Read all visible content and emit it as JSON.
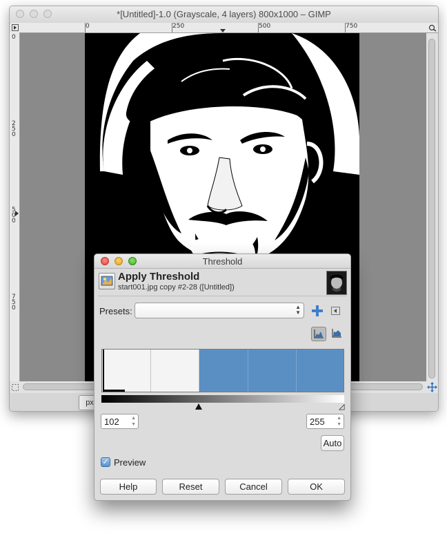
{
  "image_window": {
    "title": "*[Untitled]-1.0 (Grayscale, 4 layers) 800x1000 – GIMP",
    "h_ruler_labels": [
      "0",
      "250",
      "500",
      "750"
    ],
    "v_ruler_labels": [
      "0",
      "250",
      "500",
      "750"
    ],
    "unit": "px"
  },
  "dialog": {
    "title": "Threshold",
    "heading": "Apply Threshold",
    "subtitle": "start001.jpg copy #2-28 ([Untitled])",
    "presets_label": "Presets:",
    "presets_value": "",
    "low_value": "102",
    "high_value": "255",
    "low_fraction": 0.4,
    "auto_label": "Auto",
    "preview_label": "Preview",
    "preview_checked": true,
    "buttons": {
      "help": "Help",
      "reset": "Reset",
      "cancel": "Cancel",
      "ok": "OK"
    }
  },
  "colors": {
    "selection": "#5a8fc3"
  }
}
